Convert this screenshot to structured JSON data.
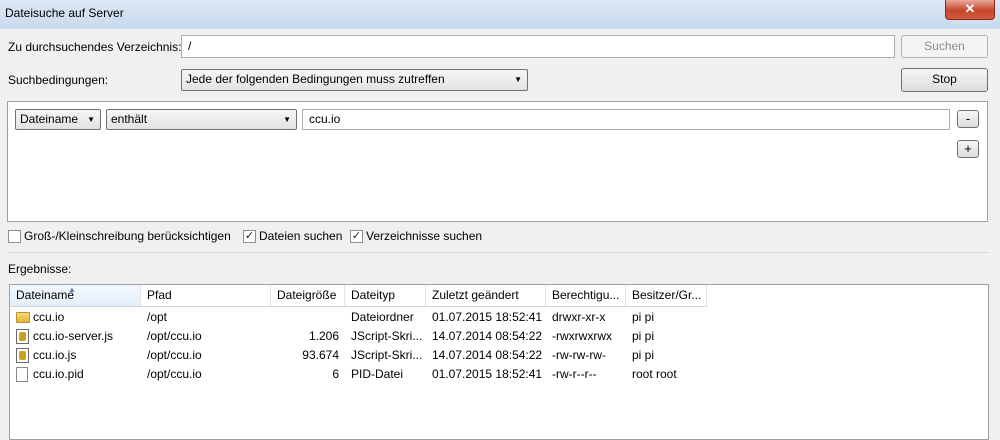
{
  "window": {
    "title": "Dateisuche auf Server",
    "close_glyph": "✕"
  },
  "search": {
    "dir_label": "Zu durchsuchendes Verzeichnis:",
    "dir_value": "/",
    "search_button": "Suchen",
    "conditions_label": "Suchbedingungen:",
    "conditions_value": "Jede der folgenden Bedingungen muss zutreffen",
    "stop_button": "Stop"
  },
  "condition": {
    "field": "Dateiname",
    "operator": "enthält",
    "value": "ccu.io",
    "remove_label": "-",
    "add_label": "+"
  },
  "options": {
    "case_label": "Groß-/Kleinschreibung berücksichtigen",
    "case_checked": false,
    "files_label": "Dateien suchen",
    "files_checked": true,
    "dirs_label": "Verzeichnisse suchen",
    "dirs_checked": true
  },
  "results": {
    "label": "Ergebnisse:",
    "columns": [
      "Dateiname",
      "Pfad",
      "Dateigröße",
      "Dateityp",
      "Zuletzt geändert",
      "Berechtigu...",
      "Besitzer/Gr..."
    ],
    "rows": [
      {
        "icon": "folder-icon",
        "name": "ccu.io",
        "path": "/opt",
        "size": "",
        "type": "Dateiordner",
        "modified": "01.07.2015 18:52:41",
        "perms": "drwxr-xr-x",
        "owner": "pi pi"
      },
      {
        "icon": "js-file-icon",
        "name": "ccu.io-server.js",
        "path": "/opt/ccu.io",
        "size": "1.206",
        "type": "JScript-Skri...",
        "modified": "14.07.2014 08:54:22",
        "perms": "-rwxrwxrwx",
        "owner": "pi pi"
      },
      {
        "icon": "js-file-icon",
        "name": "ccu.io.js",
        "path": "/opt/ccu.io",
        "size": "93.674",
        "type": "JScript-Skri...",
        "modified": "14.07.2014 08:54:22",
        "perms": "-rw-rw-rw-",
        "owner": "pi pi"
      },
      {
        "icon": "file-icon",
        "name": "ccu.io.pid",
        "path": "/opt/ccu.io",
        "size": "6",
        "type": "PID-Datei",
        "modified": "01.07.2015 18:52:41",
        "perms": "-rw-r--r--",
        "owner": "root root"
      }
    ]
  }
}
